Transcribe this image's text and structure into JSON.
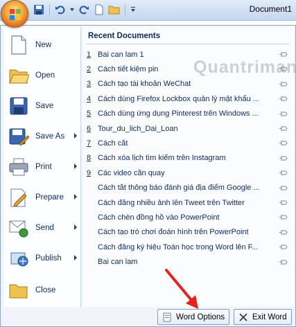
{
  "window": {
    "title": "Document1"
  },
  "quick_access": {
    "items": [
      {
        "icon": "save-icon"
      },
      {
        "icon": "undo-icon"
      },
      {
        "icon": "undo-dropdown-icon"
      },
      {
        "icon": "redo-icon"
      },
      {
        "icon": "new-document-icon"
      },
      {
        "icon": "open-folder-icon"
      },
      {
        "icon": "customize-dropdown-icon"
      }
    ]
  },
  "office_menu": {
    "commands": [
      {
        "label": "New",
        "icon": "new-document-icon",
        "submenu": false
      },
      {
        "label": "Open",
        "icon": "open-folder-icon",
        "submenu": false
      },
      {
        "label": "Save",
        "icon": "floppy-disk-icon",
        "submenu": false
      },
      {
        "label": "Save As",
        "icon": "save-as-icon",
        "submenu": true
      },
      {
        "label": "Print",
        "icon": "printer-icon",
        "submenu": true
      },
      {
        "label": "Prepare",
        "icon": "prepare-pencil-icon",
        "submenu": true
      },
      {
        "label": "Send",
        "icon": "send-icon",
        "submenu": true
      },
      {
        "label": "Publish",
        "icon": "publish-icon",
        "submenu": true
      },
      {
        "label": "Close",
        "icon": "close-folder-icon",
        "submenu": false
      }
    ],
    "recent": {
      "heading": "Recent Documents",
      "items": [
        {
          "num": "1",
          "name": "Bai can lam 1"
        },
        {
          "num": "2",
          "name": "Cách tiết kiệm pin"
        },
        {
          "num": "3",
          "name": "Cách tạo tài khoản WeChat"
        },
        {
          "num": "4",
          "name": "Cách dùng Firefox Lockbox quản lý mật khẩu ..."
        },
        {
          "num": "5",
          "name": "Cách dùng ứng dụng Pinterest trên Windows ..."
        },
        {
          "num": "6",
          "name": "Tour_du_lich_Dai_Loan"
        },
        {
          "num": "7",
          "name": "Cách cắt"
        },
        {
          "num": "8",
          "name": "Cách xóa lịch tìm kiếm trên Instagram"
        },
        {
          "num": "9",
          "name": "Các video cần quay"
        },
        {
          "num": "",
          "name": "Cách tắt thông báo đánh giá địa điểm Google ..."
        },
        {
          "num": "",
          "name": "Cách đăng nhiều ảnh lên Tweet trên Twitter"
        },
        {
          "num": "",
          "name": "Cách chèn đồng hồ vào PowerPoint"
        },
        {
          "num": "",
          "name": "Cách tạo trò chơi đoán hình trên PowerPoint"
        },
        {
          "num": "",
          "name": "Cách đăng ký hiệu Toán học trong Word lên F..."
        },
        {
          "num": "",
          "name": "Bai can lam"
        }
      ]
    },
    "footer": {
      "options_label": "Word Options",
      "exit_label": "Exit Word"
    }
  },
  "watermark": "Quantrimang",
  "colors": {
    "accent_text": "#0e2a5e",
    "annotation_arrow": "#e8231b",
    "office_button": "#e2711f"
  }
}
